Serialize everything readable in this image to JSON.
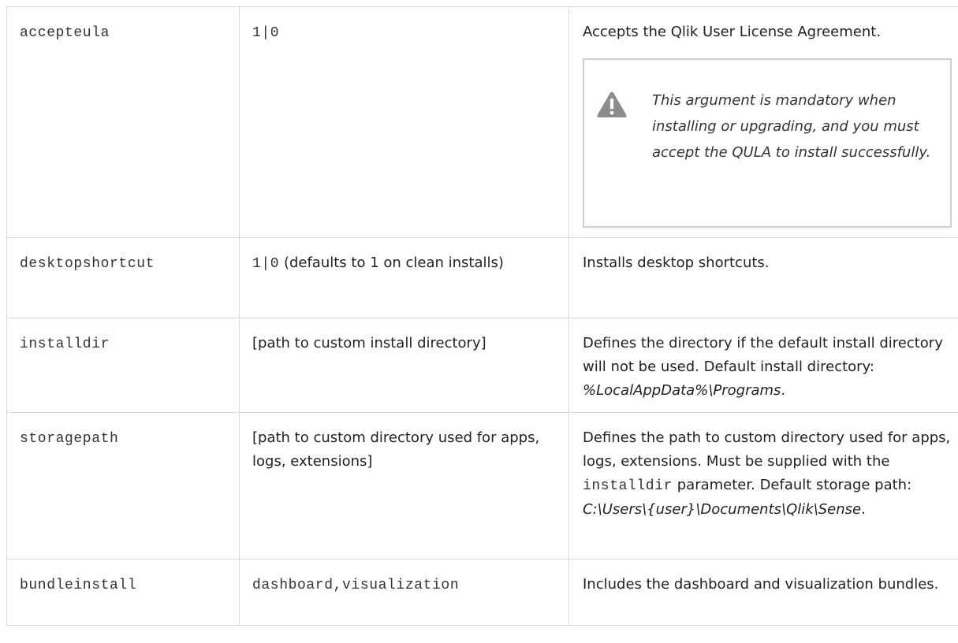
{
  "rows": [
    {
      "argument": "accepteula",
      "value": "1|0",
      "description": "Accepts the Qlik User License Agreement.",
      "warning": "This argument is mandatory when installing or upgrading, and you must accept the QULA to install successfully."
    },
    {
      "argument": "desktopshortcut",
      "value_mono": "1|0",
      "value_text": " (defaults to 1 on clean installs)",
      "description": "Installs desktop shortcuts."
    },
    {
      "argument": "installdir",
      "value": "[path to custom install directory]",
      "description_pre": "Defines the directory if the default install directory will not be used. Default install directory: ",
      "description_italic": "%LocalAppData%\\Programs",
      "description_post": "."
    },
    {
      "argument": "storagepath",
      "value": "[path to custom directory used for apps, logs, extensions]",
      "description_pre": "Defines the path to custom directory used for apps, logs, extensions. Must be supplied with the ",
      "description_mono": "installdir",
      "description_mid": " parameter. Default storage path: ",
      "description_italic": "C:\\Users\\{user}\\Documents\\Qlik\\Sense",
      "description_post": "."
    },
    {
      "argument": "bundleinstall",
      "value": "dashboard,visualization",
      "description": "Includes the dashboard and visualization bundles."
    }
  ],
  "icons": {
    "warning": "warning-icon"
  },
  "colors": {
    "warning_icon": "#8c8c8c",
    "border": "#d9d9d9"
  }
}
